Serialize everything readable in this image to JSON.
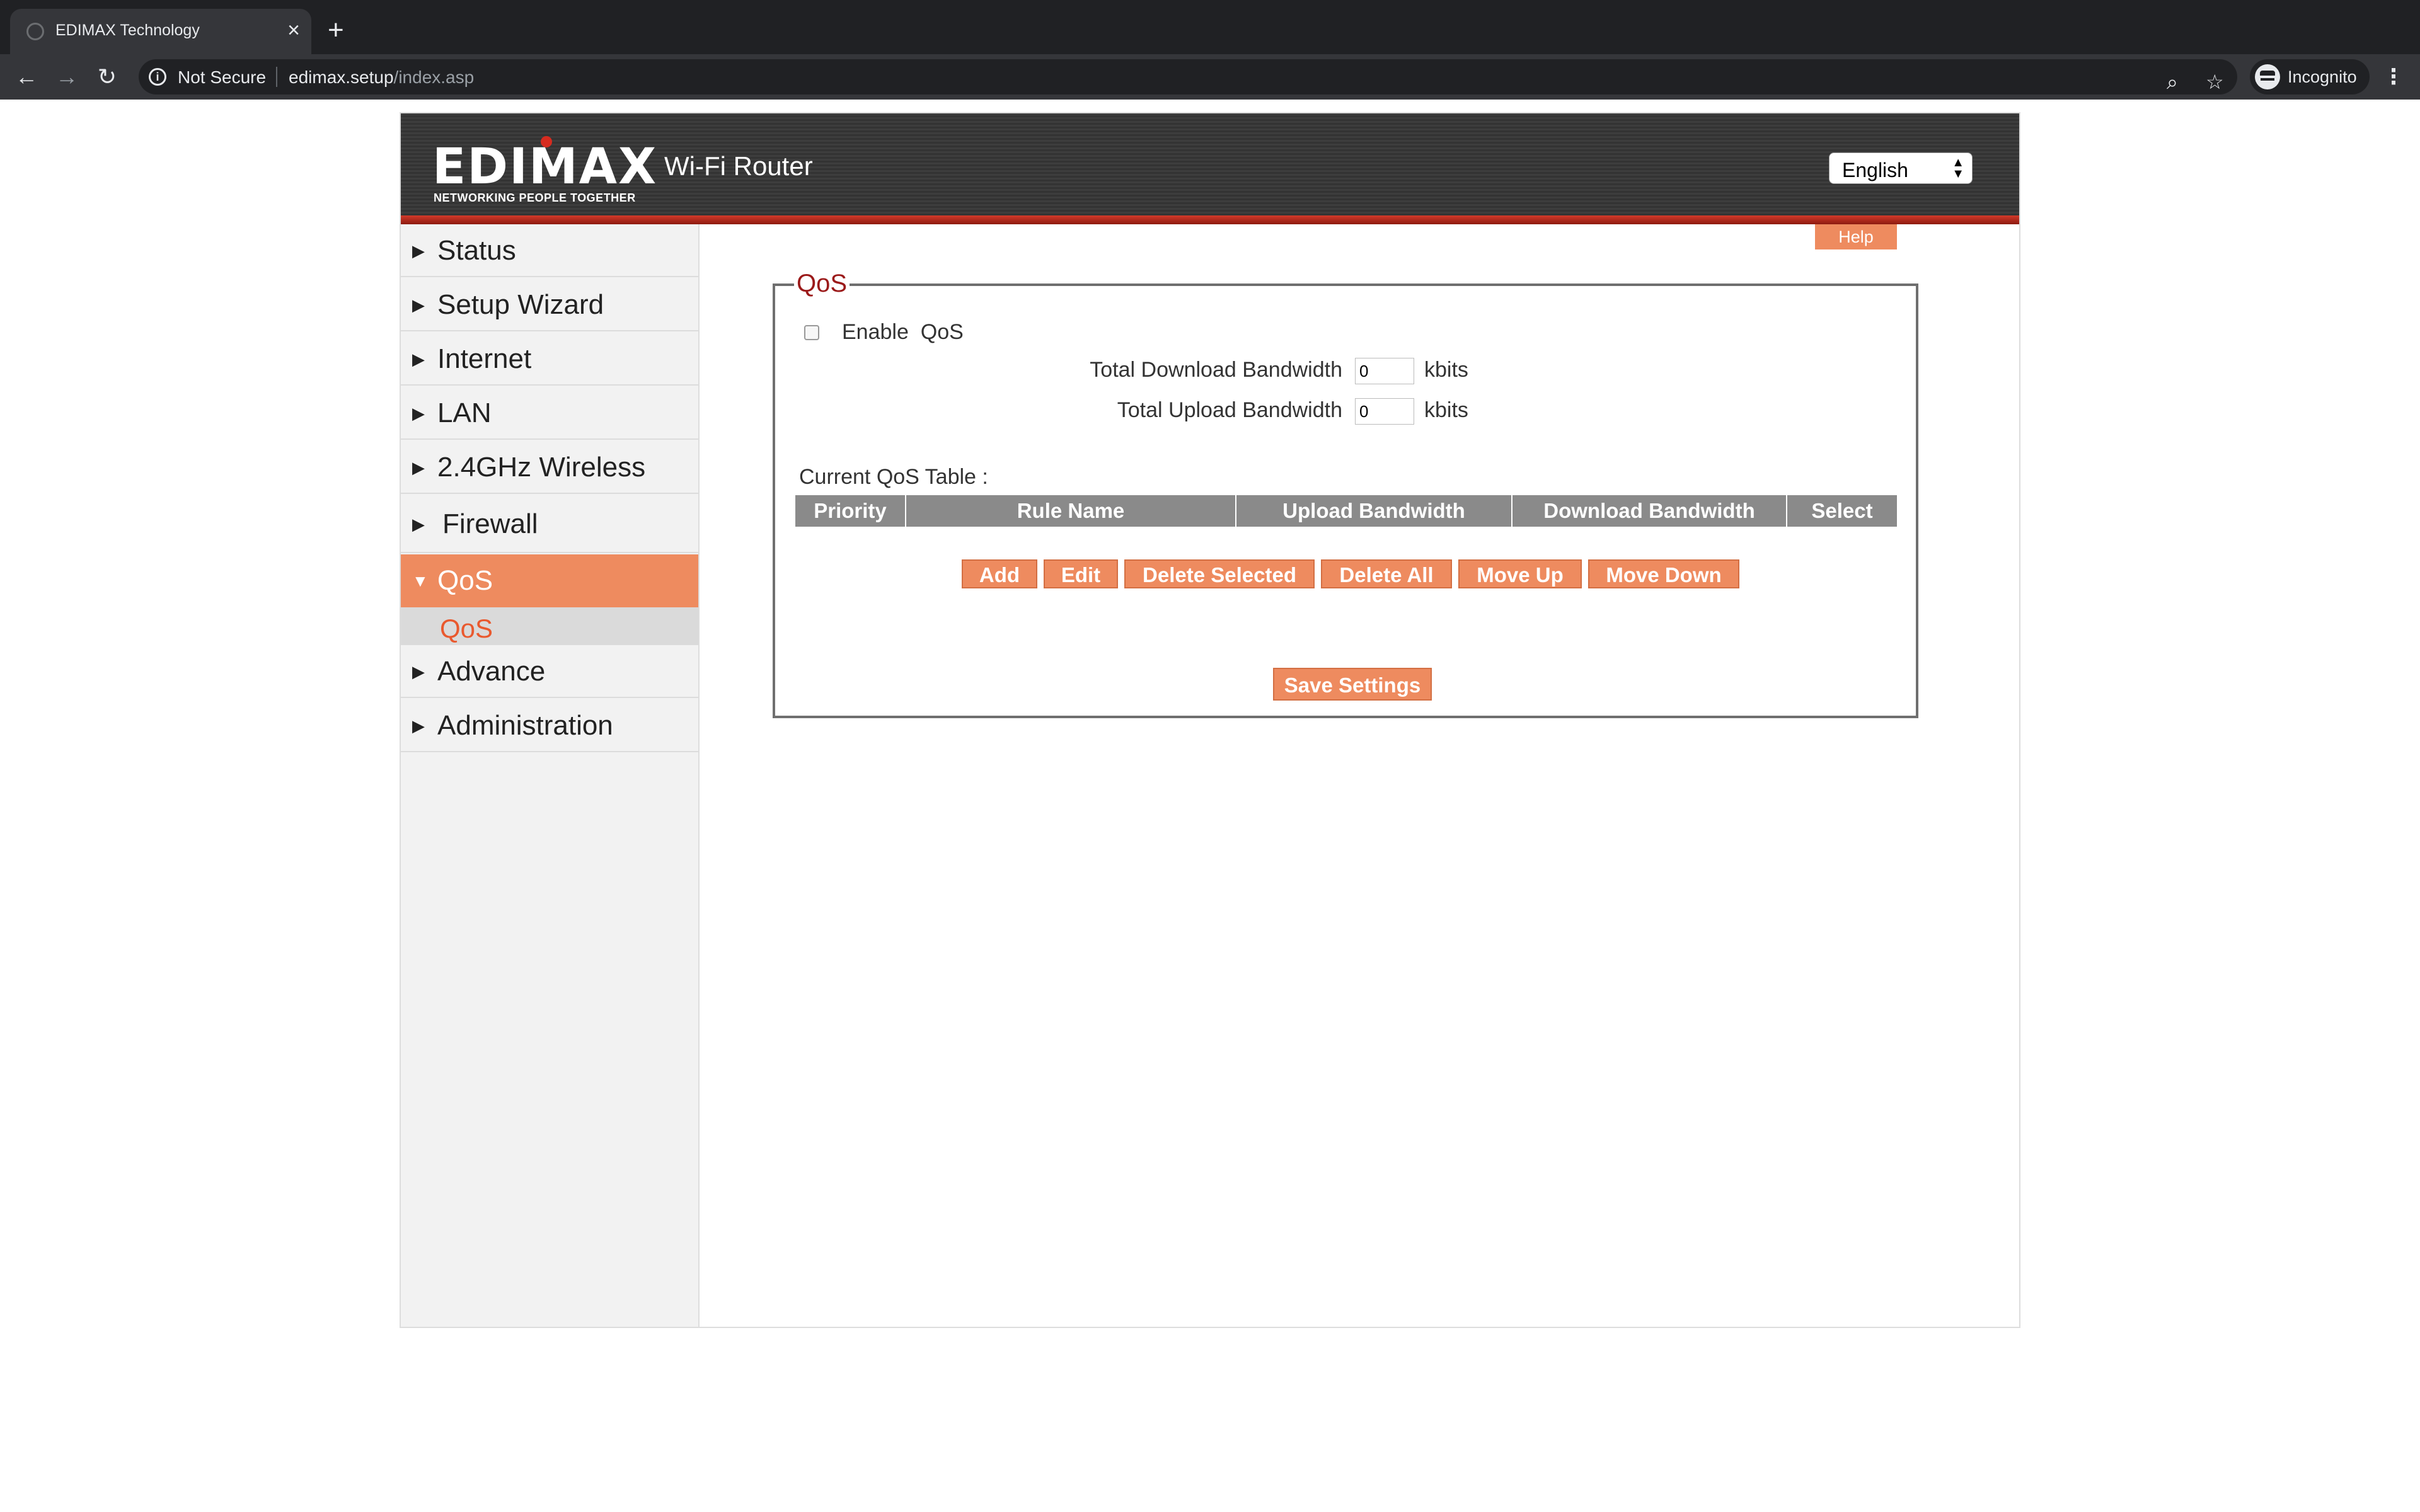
{
  "browser": {
    "tab_title": "EDIMAX Technology",
    "tab_close": "×",
    "new_tab": "+",
    "security_label": "Not Secure",
    "url_host": "edimax.setup",
    "url_path": "/index.asp",
    "profile_label": "Incognito",
    "back": "←",
    "forward": "→",
    "reload": "↻",
    "zoom": "⌕",
    "bookmark": "☆",
    "menu": "⋮"
  },
  "header": {
    "logo_text": "EDIMAX",
    "logo_tagline": "NETWORKING PEOPLE TOGETHER",
    "product_title": "Wi-Fi Router",
    "language": "English"
  },
  "sidebar": {
    "items": [
      {
        "label": "Status",
        "arrow": "▶"
      },
      {
        "label": "Setup Wizard",
        "arrow": "▶"
      },
      {
        "label": "Internet",
        "arrow": "▶"
      },
      {
        "label": "LAN",
        "arrow": "▶"
      },
      {
        "label": "2.4GHz Wireless",
        "arrow": "▶"
      },
      {
        "label": "Firewall",
        "arrow": "▶"
      },
      {
        "label": "QoS",
        "arrow": "▼"
      },
      {
        "label": "Advance",
        "arrow": "▶"
      },
      {
        "label": "Administration",
        "arrow": "▶"
      }
    ],
    "sub_item": "QoS",
    "active_color": "#ee8b5f"
  },
  "main": {
    "help_label": "Help",
    "section_title": "QoS",
    "enable_label": "Enable  QoS",
    "enable_checked": false,
    "download_label": "Total Download Bandwidth",
    "download_value": "0",
    "upload_label": "Total Upload Bandwidth",
    "upload_value": "0",
    "unit": "kbits",
    "table_caption": "Current QoS Table :",
    "table_headers": [
      "Priority",
      "Rule Name",
      "Upload Bandwidth",
      "Download Bandwidth",
      "Select"
    ],
    "buttons": [
      "Add",
      "Edit",
      "Delete Selected",
      "Delete All",
      "Move Up",
      "Move Down"
    ],
    "save_label": "Save Settings"
  }
}
